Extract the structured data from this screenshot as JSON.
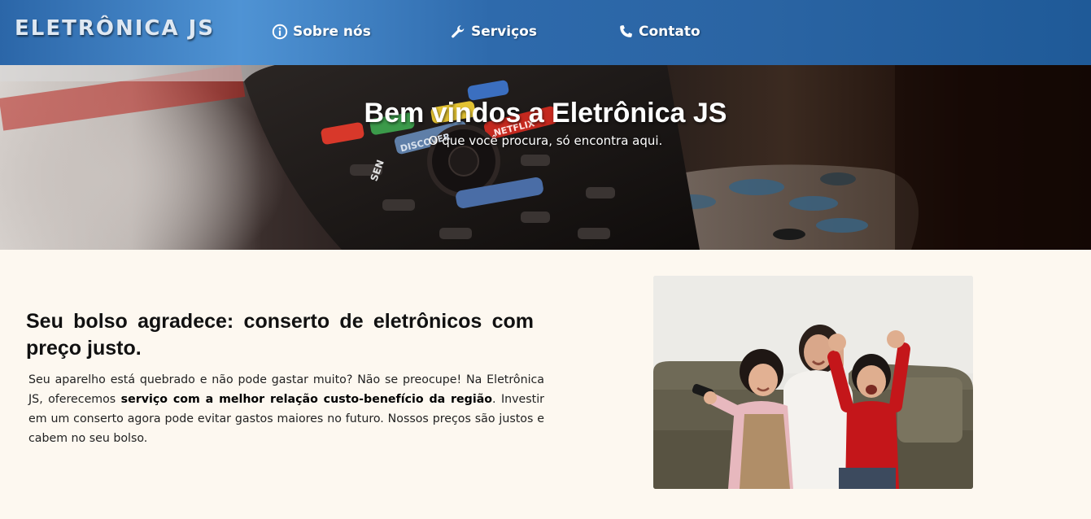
{
  "navbar": {
    "logo": "ELETRÔNICA JS",
    "items": [
      {
        "label": "Sobre nós",
        "icon": "info-icon"
      },
      {
        "label": "Serviços",
        "icon": "wrench-icon"
      },
      {
        "label": "Contato",
        "icon": "phone-icon"
      }
    ]
  },
  "hero": {
    "title": "Bem vindos a Eletrônica JS",
    "subtitle": "O que você procura, só encontra aqui.",
    "remote_labels": [
      "DISCOVER",
      "NETFLIX",
      "SEN"
    ]
  },
  "section": {
    "heading": "Seu bolso agradece: conserto de eletrônicos com preço justo.",
    "paragraph_part1": "Seu aparelho está quebrado e não pode gastar muito? Não se preocupe! Na Eletrônica JS, oferecemos ",
    "paragraph_bold": "serviço com a melhor relação custo-benefício da região",
    "paragraph_part2": ". Investir em um conserto agora pode evitar gastos maiores no futuro. Nossos preços são justos e cabem no seu bolso."
  },
  "colors": {
    "navbar": "#2b66a8",
    "page_background": "#fdf8f0",
    "text": "#111111"
  }
}
